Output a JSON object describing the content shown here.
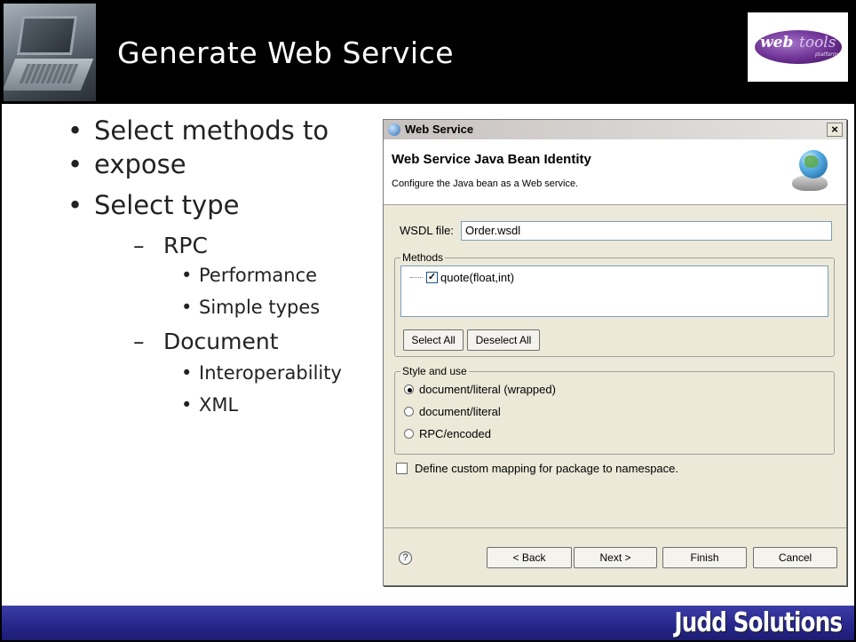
{
  "slide": {
    "title": "Generate Web Service",
    "logo_text_a": "web",
    "logo_text_b": "tools",
    "logo_text_c": "platform",
    "brand": "Judd Solutions"
  },
  "bullets": {
    "item1": "Select methods to",
    "item1_cont": "expose",
    "item2": "Select type",
    "rpc": "RPC",
    "rpc_sub1": "Performance",
    "rpc_sub2": "Simple types",
    "document": "Document",
    "doc_sub1": "Interoperability",
    "doc_sub2": "XML"
  },
  "dialog": {
    "window_title": "Web Service",
    "close_glyph": "×",
    "heading": "Web Service Java Bean Identity",
    "subheading": "Configure the Java bean as a Web service.",
    "wsdl_label": "WSDL file:",
    "wsdl_value": "Order.wsdl",
    "methods_legend": "Methods",
    "method_checked_glyph": "✓",
    "method_label": "quote(float,int)",
    "select_all": "Select All",
    "deselect_all": "Deselect All",
    "style_legend": "Style and use",
    "style_options": [
      "document/literal (wrapped)",
      "document/literal",
      "RPC/encoded"
    ],
    "style_selected": "document/literal (wrapped)",
    "custom_mapping_label": "Define custom mapping for package to namespace.",
    "help_glyph": "?",
    "back": "< Back",
    "next": "Next >",
    "finish": "Finish",
    "cancel": "Cancel"
  }
}
